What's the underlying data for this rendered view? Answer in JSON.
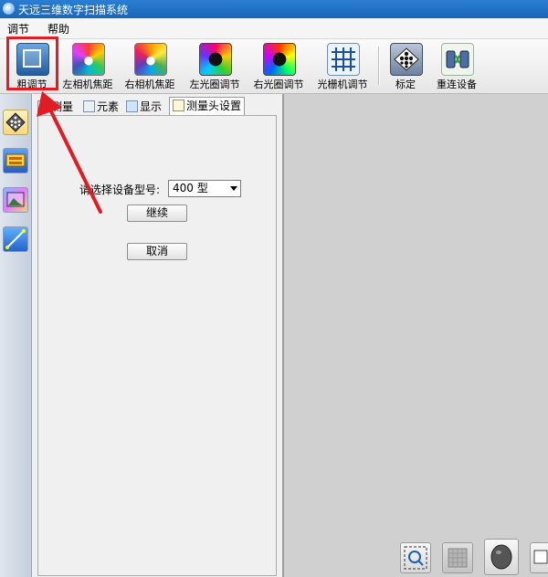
{
  "window": {
    "title": "天远三维数字扫描系统"
  },
  "menu": {
    "items": [
      "调节",
      "帮助"
    ]
  },
  "toolbar": {
    "buttons": [
      {
        "label": "粗调节",
        "icon": "rough-adjust-icon"
      },
      {
        "label": "左相机焦距",
        "icon": "left-camera-focus-icon"
      },
      {
        "label": "右相机焦距",
        "icon": "right-camera-focus-icon"
      },
      {
        "label": "左光圈调节",
        "icon": "left-aperture-icon"
      },
      {
        "label": "右光圈调节",
        "icon": "right-aperture-icon"
      },
      {
        "label": "光栅机调节",
        "icon": "grating-icon"
      },
      {
        "label": "标定",
        "icon": "calibration-icon"
      },
      {
        "label": "重连设备",
        "icon": "reconnect-device-icon"
      }
    ],
    "selected": "粗调节"
  },
  "sidebar": {
    "icons": [
      "calibration-board-icon",
      "scanner-icon",
      "image-icon",
      "measure-icon"
    ]
  },
  "tabs": [
    {
      "label": "测量",
      "icon": "measure-tab-icon"
    },
    {
      "label": "元素",
      "icon": "element-tab-icon"
    },
    {
      "label": "显示",
      "icon": "display-tab-icon"
    },
    {
      "label": "测量头设置",
      "icon": "head-settings-tab-icon"
    }
  ],
  "active_tab": "测量头设置",
  "form": {
    "model_label": "请选择设备型号:",
    "model_value": "400 型",
    "continue_label": "继续",
    "cancel_label": "取消"
  },
  "bottom_toolbar": {
    "icons": [
      "zoom-fit-icon",
      "texture-icon",
      "model-view-icon",
      "screen-icon"
    ]
  },
  "colors": {
    "highlight": "#e21c24",
    "titlebar": "#1f6fc4"
  }
}
